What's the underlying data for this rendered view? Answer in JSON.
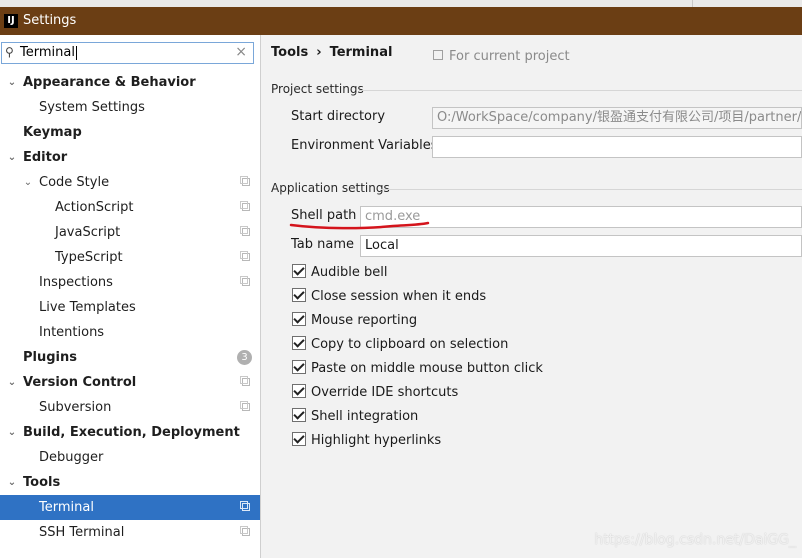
{
  "window": {
    "title": "Settings",
    "logo_text": "IJ"
  },
  "search": {
    "value": "Terminal"
  },
  "sidebar": {
    "items": [
      {
        "label": "Appearance & Behavior",
        "level": 0,
        "bold": true,
        "arrow": "expanded"
      },
      {
        "label": "System Settings",
        "level": 1
      },
      {
        "label": "Keymap",
        "level": 0,
        "bold": true
      },
      {
        "label": "Editor",
        "level": 0,
        "bold": true,
        "arrow": "expanded"
      },
      {
        "label": "Code Style",
        "level": 1,
        "arrow": "expanded",
        "copy_icon": true
      },
      {
        "label": "ActionScript",
        "level": 2,
        "copy_icon": true
      },
      {
        "label": "JavaScript",
        "level": 2,
        "copy_icon": true
      },
      {
        "label": "TypeScript",
        "level": 2,
        "copy_icon": true
      },
      {
        "label": "Inspections",
        "level": 1,
        "copy_icon": true
      },
      {
        "label": "Live Templates",
        "level": 1
      },
      {
        "label": "Intentions",
        "level": 1
      },
      {
        "label": "Plugins",
        "level": 0,
        "bold": true,
        "badge": "3"
      },
      {
        "label": "Version Control",
        "level": 0,
        "bold": true,
        "arrow": "expanded",
        "copy_icon": true
      },
      {
        "label": "Subversion",
        "level": 1,
        "copy_icon": true
      },
      {
        "label": "Build, Execution, Deployment",
        "level": 0,
        "bold": true,
        "arrow": "expanded"
      },
      {
        "label": "Debugger",
        "level": 1
      },
      {
        "label": "Tools",
        "level": 0,
        "bold": true,
        "arrow": "expanded"
      },
      {
        "label": "Terminal",
        "level": 1,
        "selected": true,
        "copy_icon": true
      },
      {
        "label": "SSH Terminal",
        "level": 1,
        "copy_icon": true
      }
    ]
  },
  "main": {
    "breadcrumb": {
      "parent": "Tools",
      "separator": "›",
      "current": "Terminal"
    },
    "scope_label": "For current project",
    "project_settings": {
      "title": "Project settings",
      "start_directory_label": "Start directory",
      "start_directory_value": "O:/WorkSpace/company/银盈通支付有限公司/项目/partner/svn/t",
      "env_vars_label": "Environment Variables",
      "env_vars_value": ""
    },
    "application_settings": {
      "title": "Application settings",
      "shell_path_label": "Shell path",
      "shell_path_placeholder": "cmd.exe",
      "tab_name_label": "Tab name",
      "tab_name_value": "Local",
      "checkboxes": [
        {
          "label": "Audible bell",
          "checked": true
        },
        {
          "label": "Close session when it ends",
          "checked": true
        },
        {
          "label": "Mouse reporting",
          "checked": true
        },
        {
          "label": "Copy to clipboard on selection",
          "checked": true
        },
        {
          "label": "Paste on middle mouse button click",
          "checked": true
        },
        {
          "label": "Override IDE shortcuts",
          "checked": true
        },
        {
          "label": "Shell integration",
          "checked": true
        },
        {
          "label": "Highlight hyperlinks",
          "checked": true
        }
      ]
    }
  },
  "watermark": "https://blog.csdn.net/DaiGG_",
  "colors": {
    "title_bar": "#6b3e14",
    "selection": "#2f72c4",
    "annotation_underline": "#d4141c"
  }
}
